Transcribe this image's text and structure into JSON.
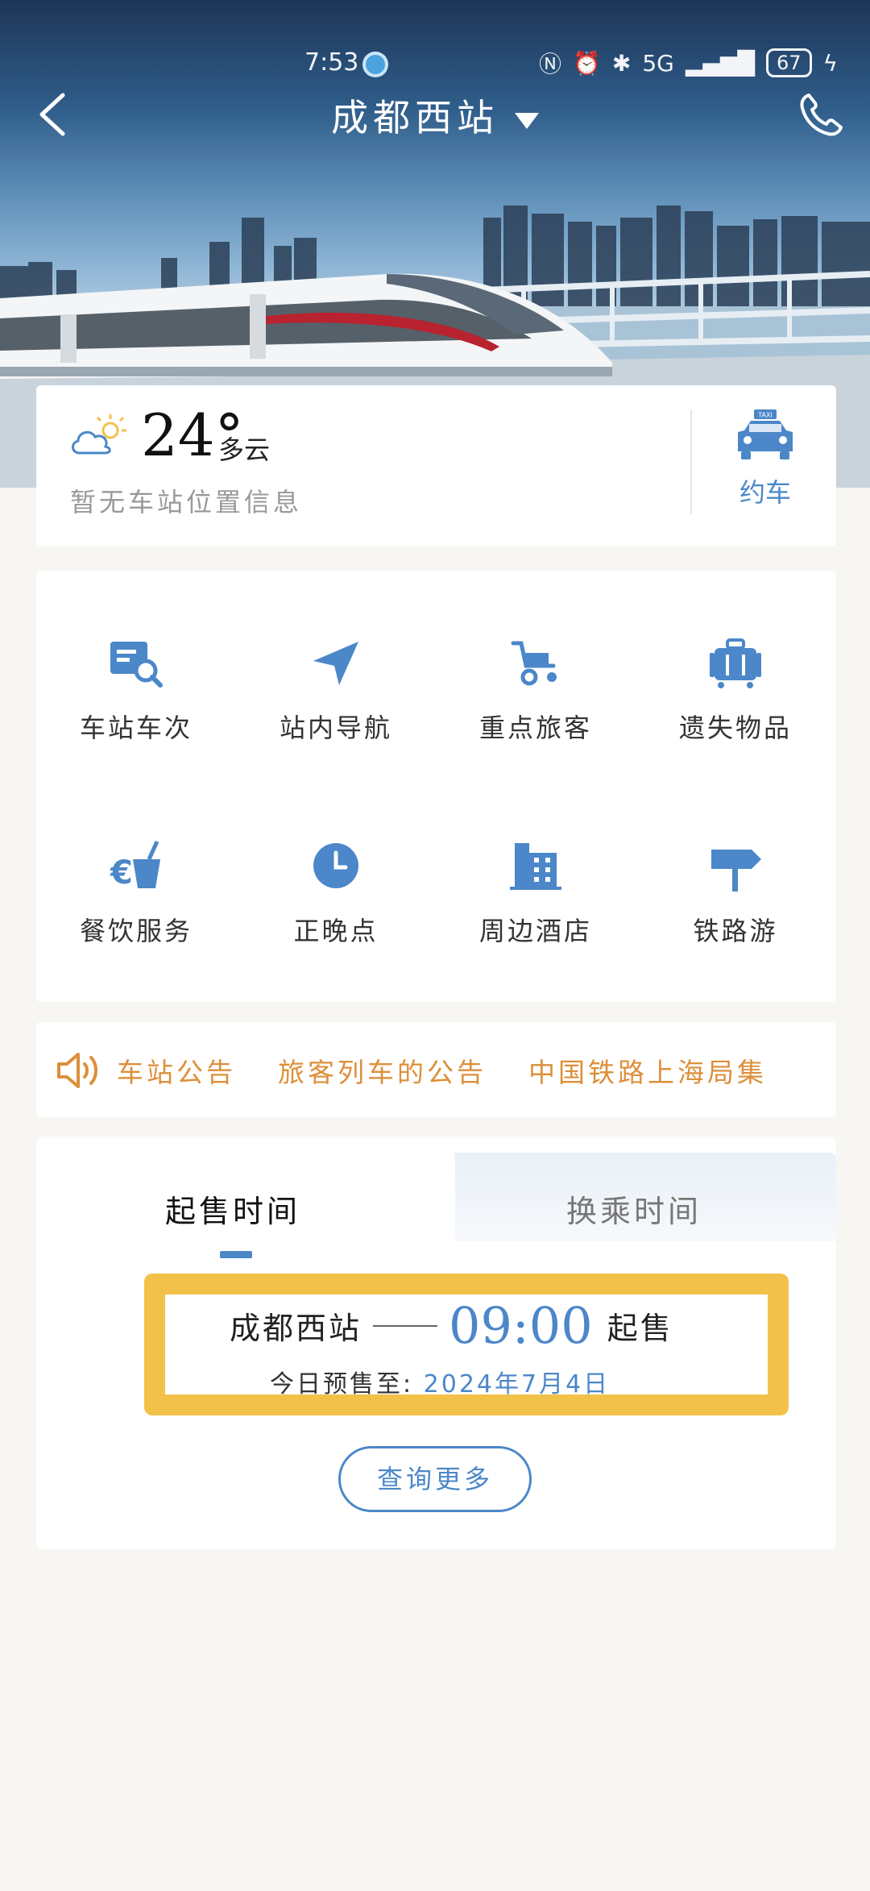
{
  "status_bar": {
    "time": "7:53",
    "network": "5G",
    "battery": "67"
  },
  "header": {
    "station_name": "成都西站"
  },
  "weather": {
    "temperature": "24°",
    "condition": "多云",
    "location_info": "暂无车站位置信息",
    "taxi_label": "约车",
    "taxi_sign": "TAXI"
  },
  "services": [
    {
      "label": "车站车次",
      "icon": "schedule-search-icon"
    },
    {
      "label": "站内导航",
      "icon": "navigation-arrow-icon"
    },
    {
      "label": "重点旅客",
      "icon": "wheelchair-icon"
    },
    {
      "label": "遗失物品",
      "icon": "luggage-icon"
    },
    {
      "label": "餐饮服务",
      "icon": "drink-cup-icon"
    },
    {
      "label": "正晚点",
      "icon": "clock-icon"
    },
    {
      "label": "周边酒店",
      "icon": "hotel-building-icon"
    },
    {
      "label": "铁路游",
      "icon": "signpost-icon"
    }
  ],
  "notice": {
    "title": "车站公告",
    "items": [
      "旅客列车的公告",
      "中国铁路上海局集"
    ]
  },
  "sale_time": {
    "tabs": [
      "起售时间",
      "换乘时间"
    ],
    "active_tab": "起售时间",
    "station": "成都西站",
    "time": "09:00",
    "suffix": "起售",
    "presale_label": "今日预售至:",
    "presale_date": "2024年7月4日",
    "more_button": "查询更多"
  },
  "colors": {
    "accent_blue": "#4b87c9",
    "notice_orange": "#dd8f3a",
    "highlight_yellow": "#f2c14a"
  }
}
